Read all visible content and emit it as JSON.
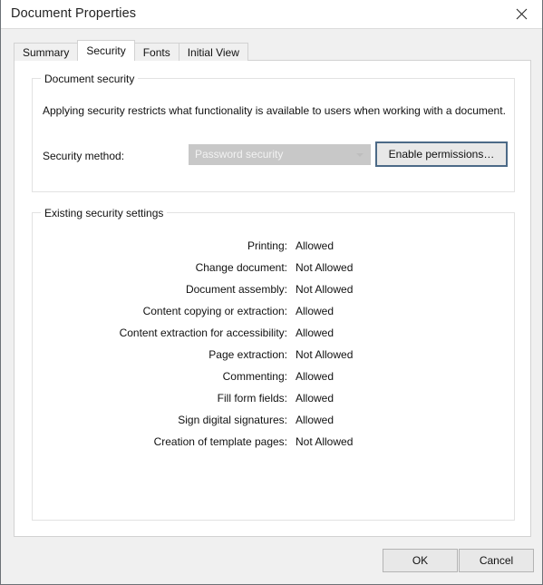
{
  "window": {
    "title": "Document Properties",
    "close_icon": "close-icon"
  },
  "tabs": [
    {
      "label": "Summary",
      "active": false
    },
    {
      "label": "Security",
      "active": true
    },
    {
      "label": "Fonts",
      "active": false
    },
    {
      "label": "Initial View",
      "active": false
    }
  ],
  "document_security": {
    "legend": "Document security",
    "description": "Applying security restricts what functionality is available to users when working with a document.",
    "method_label": "Security method:",
    "method_value": "Password security",
    "method_disabled": true,
    "enable_button": "Enable permissions…"
  },
  "existing_security": {
    "legend": "Existing security settings",
    "rows": [
      {
        "label": "Printing:",
        "value": "Allowed"
      },
      {
        "label": "Change document:",
        "value": "Not Allowed"
      },
      {
        "label": "Document assembly:",
        "value": "Not Allowed"
      },
      {
        "label": "Content copying or extraction:",
        "value": "Allowed"
      },
      {
        "label": "Content extraction for accessibility:",
        "value": "Allowed"
      },
      {
        "label": "Page extraction:",
        "value": "Not Allowed"
      },
      {
        "label": "Commenting:",
        "value": "Allowed"
      },
      {
        "label": "Fill form fields:",
        "value": "Allowed"
      },
      {
        "label": "Sign digital signatures:",
        "value": "Allowed"
      },
      {
        "label": "Creation of template pages:",
        "value": "Not Allowed"
      }
    ]
  },
  "footer": {
    "ok_label": "OK",
    "cancel_label": "Cancel"
  },
  "colors": {
    "window_background": "#f0f0f0",
    "panel_background": "#ffffff",
    "focus_border": "#4c6a87",
    "disabled_field": "#c8c8c8",
    "button_face": "#e8e8e8"
  }
}
